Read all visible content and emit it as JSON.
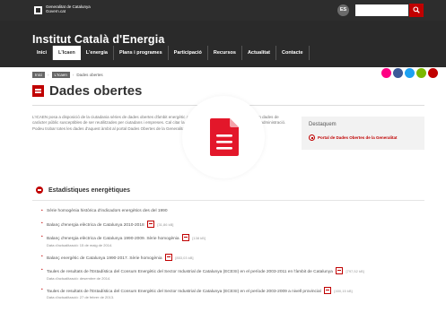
{
  "top_bar": {
    "gencat_logo_text": "Generalitat de Catalunya Govern.cat",
    "language": "ES",
    "search_placeholder": ""
  },
  "header": {
    "site_title": "Institut Català d'Energia",
    "nav": [
      {
        "label": "Inici",
        "active": false
      },
      {
        "label": "L'Icaen",
        "active": true
      },
      {
        "label": "L'energia",
        "active": false
      },
      {
        "label": "Plans i programes",
        "active": false
      },
      {
        "label": "Participació",
        "active": false
      },
      {
        "label": "Recursos",
        "active": false
      },
      {
        "label": "Actualitat",
        "active": false
      },
      {
        "label": "Contacte",
        "active": false
      }
    ]
  },
  "breadcrumb": {
    "items": [
      "Inici",
      "L'Icaen",
      "Dades obertes"
    ]
  },
  "social_icons": [
    {
      "name": "flickr-icon",
      "color": "#ff0084"
    },
    {
      "name": "facebook-icon",
      "color": "#3b5998"
    },
    {
      "name": "twitter-icon",
      "color": "#1da1f2"
    },
    {
      "name": "flickr-icon",
      "color": "#7ab800"
    },
    {
      "name": "youtube-icon",
      "color": "#c00000"
    }
  ],
  "page": {
    "title": "Dades obertes",
    "intro": "L'ICAEN posa a disposició de la ciutadania sèries de dades obertes d'àmbit energètic a través del portal de Dades Obertes; són dades de caràcter públic susceptibles de ser reutilitzades per ciutadans i empreses. Cal citar la referència de la informació procedent de l'administració. Podeu trobar totes les dades d'aquest àmbit al portal Dades Obertes de la Generalitat de Catalunya."
  },
  "aside": {
    "heading": "Destaquem",
    "link": "Portal de Dades Obertes de la Generalitat"
  },
  "section": {
    "title": "Estadístiques energètiques",
    "items": [
      {
        "text": "Sèrie homogènia històrica d'indicadors energètics des del 1990",
        "size": "",
        "updated": ""
      },
      {
        "text": "Balanç d'energia elèctrica de Catalunya 2010-2018",
        "size": "[31,86 kB]",
        "updated": ""
      },
      {
        "text": "Balanç d'energia elèctrica de Catalunya 1990-2009. Sèrie homogènia",
        "size": "[138 kB]",
        "updated": "Data d'actualització: 15 de maig de 2014."
      },
      {
        "text": "Balanç energètic de Catalunya 1990-2017. Sèrie homogènia",
        "size": "[853,03 kB]",
        "updated": ""
      },
      {
        "text": "Taules de resultats de l'Estadística del Consum Energètic del Sector Industrial de Catalunya (ECESI) en el període 2003-2011 en l'àmbit de Catalunya",
        "size": "[797,52 kB]",
        "updated": "Data d'actualització: desembre de 2014."
      },
      {
        "text": "Taules de resultats de l'Estadística del Consum Energètic del Sector Industrial de Catalunya (ECESI) en el període 2003-2009 a nivell provincial",
        "size": "[400,15 kB]",
        "updated": "Data d'actualització: 27 de febrer de 2013."
      }
    ]
  },
  "overlay": {
    "icon": "document-icon",
    "color": "#e3172a"
  }
}
